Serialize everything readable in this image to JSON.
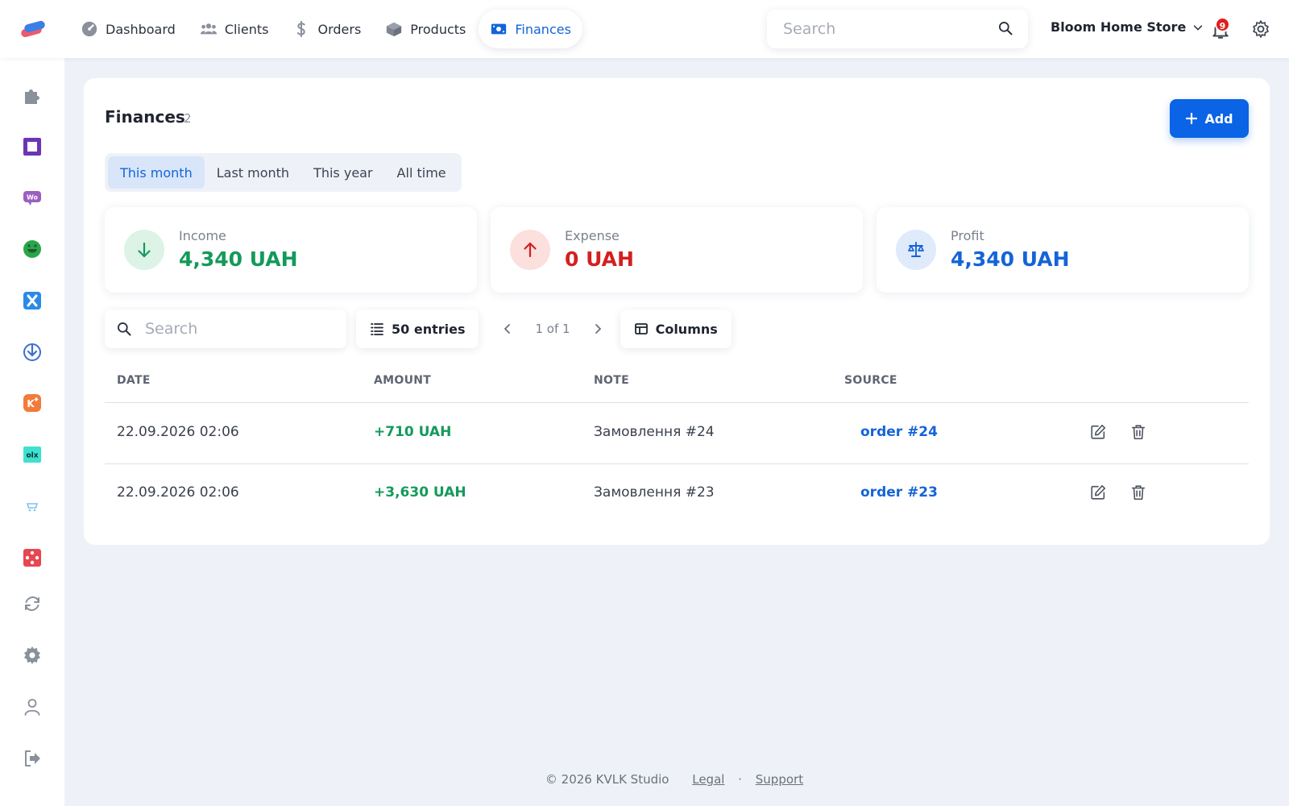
{
  "nav": {
    "items": [
      {
        "label": "Dashboard",
        "icon": "dashboard-icon"
      },
      {
        "label": "Clients",
        "icon": "users-icon"
      },
      {
        "label": "Orders",
        "icon": "dollar-icon"
      },
      {
        "label": "Products",
        "icon": "box-icon"
      },
      {
        "label": "Finances",
        "icon": "money-icon",
        "active": true
      }
    ],
    "search_placeholder": "Search",
    "store_name": "Bloom Home Store",
    "notifications_count": "9"
  },
  "sidebar": {
    "icons": [
      "puzzle-icon",
      "square-icon",
      "woo-icon",
      "smile-icon",
      "x-icon",
      "download-circle-icon",
      "k-plus-icon",
      "olx-icon",
      "cart-icon",
      "network-icon",
      "sync-icon",
      "gear-icon",
      "user-icon",
      "logout-icon"
    ]
  },
  "page": {
    "title": "Finances",
    "count": "2",
    "add_label": "Add",
    "periods": [
      "This month",
      "Last month",
      "This year",
      "All time"
    ],
    "active_period": "This month"
  },
  "stats": {
    "income": {
      "label": "Income",
      "value": "4,340 UAH"
    },
    "expense": {
      "label": "Expense",
      "value": "0 UAH"
    },
    "profit": {
      "label": "Profit",
      "value": "4,340 UAH"
    }
  },
  "toolbar": {
    "search_placeholder": "Search",
    "entries_label": "50 entries",
    "pager_text": "1 of 1",
    "columns_label": "Columns"
  },
  "table": {
    "headers": [
      "DATE",
      "AMOUNT",
      "NOTE",
      "SOURCE"
    ],
    "rows": [
      {
        "date": "22.09.2026 02:06",
        "amount": "+710 UAH",
        "note": "Замовлення #24",
        "source": "order #24"
      },
      {
        "date": "22.09.2026 02:06",
        "amount": "+3,630 UAH",
        "note": "Замовлення #23",
        "source": "order #23"
      }
    ]
  },
  "footer": {
    "copyright": "© 2026 KVLK Studio",
    "legal": "Legal",
    "separator": "·",
    "support": "Support"
  },
  "colors": {
    "accent": "#0b63e5",
    "income": "#149a5b",
    "expense": "#d41f1f",
    "profit": "#1464d8"
  }
}
